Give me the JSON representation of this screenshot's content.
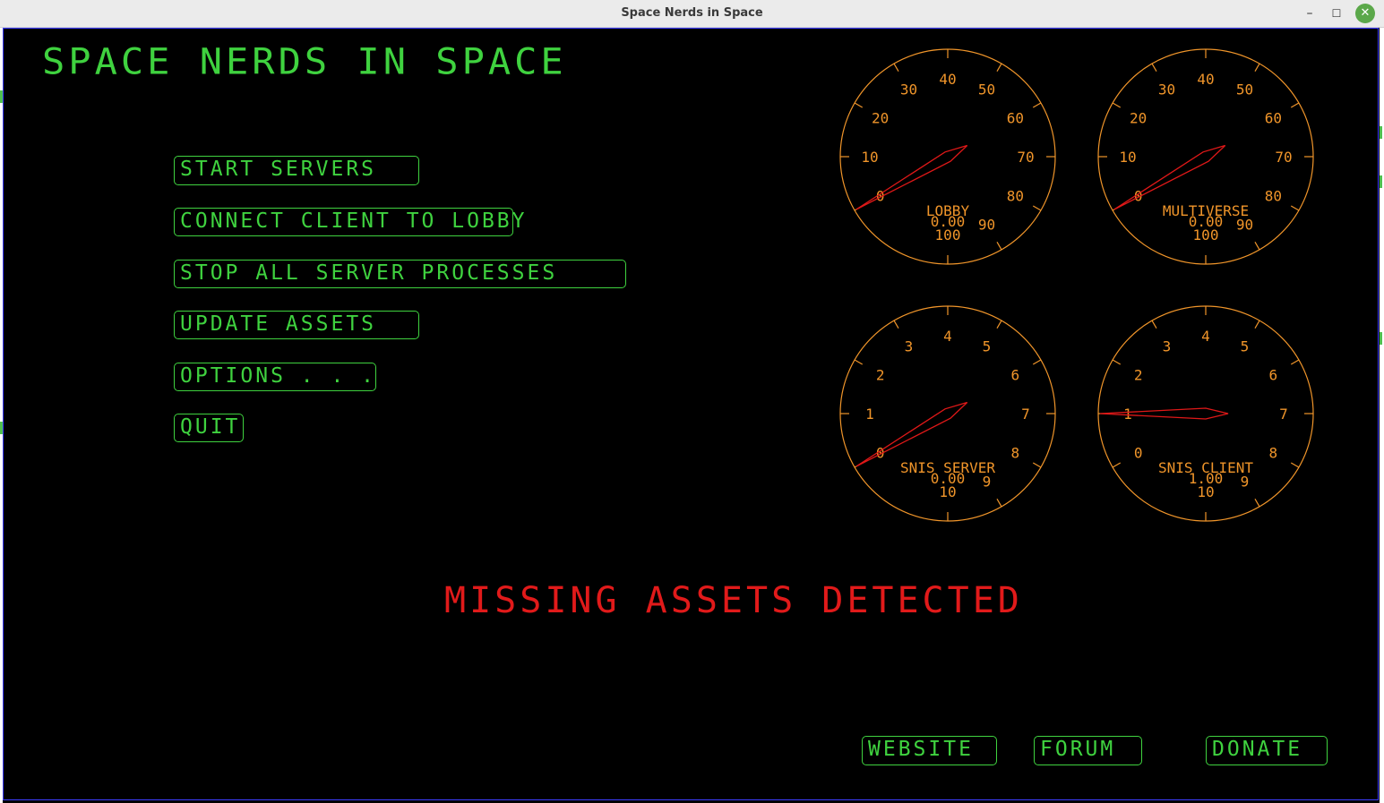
{
  "window": {
    "title": "Space Nerds in Space",
    "minimize_glyph": "–",
    "maximize_glyph": "☐",
    "close_glyph": "✕"
  },
  "app": {
    "title": "SPACE NERDS IN SPACE",
    "warning": "MISSING ASSETS DETECTED"
  },
  "menu": {
    "start_servers": "START SERVERS",
    "connect_client": "CONNECT CLIENT TO LOBBY",
    "stop_all": "STOP ALL SERVER PROCESSES",
    "update_assets": "UPDATE ASSETS",
    "options": "OPTIONS . . .",
    "quit": "QUIT"
  },
  "links": {
    "website": "WEBSITE",
    "forum": "FORUM",
    "donate": "DONATE"
  },
  "gauges": [
    {
      "id": "lobby",
      "label": "LOBBY",
      "value_text": "0.00",
      "value": 0,
      "min": 0,
      "max": 100,
      "ticks": [
        "0",
        "10",
        "20",
        "30",
        "40",
        "50",
        "60",
        "70",
        "80",
        "90",
        "100"
      ]
    },
    {
      "id": "multiverse",
      "label": "MULTIVERSE",
      "value_text": "0.00",
      "value": 0,
      "min": 0,
      "max": 100,
      "ticks": [
        "0",
        "10",
        "20",
        "30",
        "40",
        "50",
        "60",
        "70",
        "80",
        "90",
        "100"
      ]
    },
    {
      "id": "snis-server",
      "label": "SNIS SERVER",
      "value_text": "0.00",
      "value": 0,
      "min": 0,
      "max": 10,
      "ticks": [
        "0",
        "1",
        "2",
        "3",
        "4",
        "5",
        "6",
        "7",
        "8",
        "9",
        "10"
      ]
    },
    {
      "id": "snis-client",
      "label": "SNIS CLIENT",
      "value_text": "1.00",
      "value": 1,
      "min": 0,
      "max": 10,
      "ticks": [
        "0",
        "1",
        "2",
        "3",
        "4",
        "5",
        "6",
        "7",
        "8",
        "9",
        "10"
      ]
    }
  ],
  "colors": {
    "vector_green": "#3fd23f",
    "gauge_orange": "#f0952a",
    "needle_red": "#e01818",
    "warning_red": "#e11a1a"
  }
}
